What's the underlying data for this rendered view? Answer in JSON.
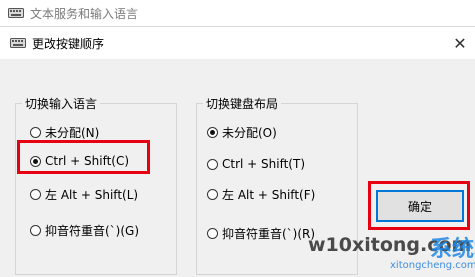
{
  "outer_window": {
    "title": "文本服务和输入语言",
    "icon": "keyboard-icon"
  },
  "dialog": {
    "title": "更改按键顺序",
    "icon": "keyboard-icon",
    "close_glyph": "✕"
  },
  "input_language_group": {
    "label": "切换输入语言",
    "options": [
      {
        "label": "未分配(N)",
        "checked": false
      },
      {
        "label": "Ctrl + Shift(C)",
        "checked": true
      },
      {
        "label": "左 Alt + Shift(L)",
        "checked": false
      },
      {
        "label": "抑音符重音(`)(G)",
        "checked": false
      }
    ]
  },
  "keyboard_layout_group": {
    "label": "切换键盘布局",
    "options": [
      {
        "label": "未分配(O)",
        "checked": true
      },
      {
        "label": "Ctrl + Shift(T)",
        "checked": false
      },
      {
        "label": "左 Alt + Shift(F)",
        "checked": false
      },
      {
        "label": "抑音符重音(`)(R)",
        "checked": false
      }
    ]
  },
  "ok_button": {
    "label": "确定"
  },
  "watermark": {
    "main": "w10xitong.com",
    "accent": "系统城",
    "sub": "xitongcheng.com"
  },
  "colors": {
    "highlight_red": "#e60012",
    "focus_blue": "#0078d7",
    "watermark_blue": "#1e88e5"
  }
}
